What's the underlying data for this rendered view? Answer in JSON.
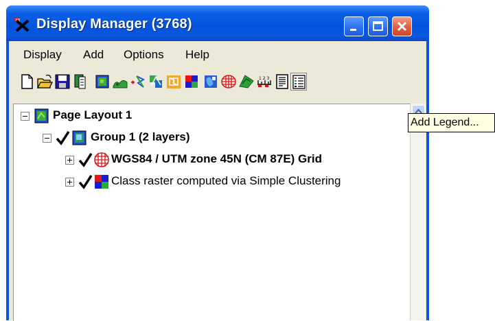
{
  "window": {
    "title": "Display Manager (3768)",
    "app_icon": "display-manager-app-icon",
    "controls": [
      "minimize-icon",
      "maximize-icon",
      "close-icon"
    ]
  },
  "menu": {
    "items": [
      "Display",
      "Add",
      "Options",
      "Help"
    ]
  },
  "toolbar": {
    "buttons": [
      "new-icon",
      "open-icon",
      "save-icon",
      "print-icon",
      "add-raster-icon",
      "add-vector-icon",
      "add-cad-icon",
      "add-shape-icon",
      "add-tin-icon",
      "add-rgb-icon",
      "add-region-icon",
      "add-grid-icon",
      "add-database-icon",
      "add-scale-bar-icon",
      "add-text-icon",
      "add-legend-icon"
    ]
  },
  "tree": {
    "page": {
      "label": "Page Layout 1"
    },
    "group": {
      "label": "Group 1   (2 layers)"
    },
    "layers": [
      {
        "label": "WGS84 / UTM zone 45N (CM 87E) Grid",
        "bold": true,
        "icon": "grid-layer-icon",
        "checked": true
      },
      {
        "label": "Class raster computed via Simple Clustering",
        "bold": false,
        "icon": "raster-layer-icon",
        "checked": true
      }
    ]
  },
  "tooltip": {
    "text": "Add Legend..."
  },
  "colors": {
    "titlebar": "#0a5fe6",
    "face": "#ece9d8",
    "tooltip_bg": "#ffffe1"
  }
}
